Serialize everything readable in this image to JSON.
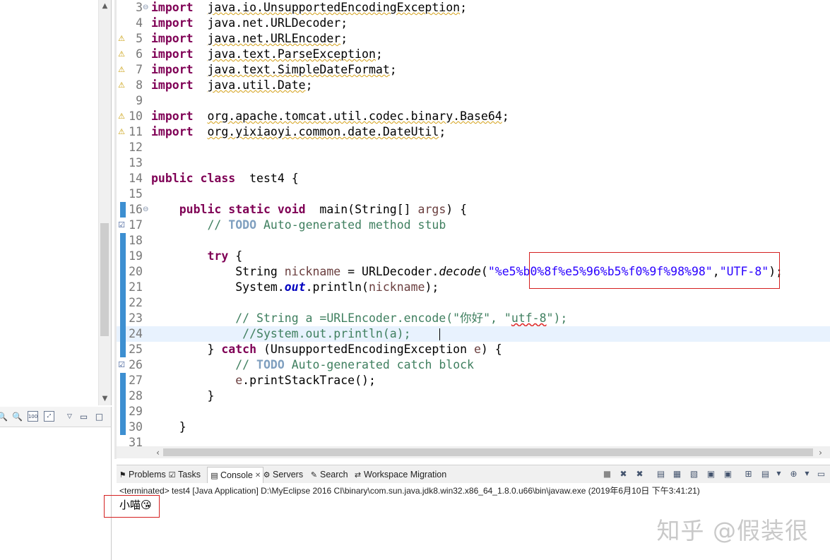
{
  "editor": {
    "lines": [
      {
        "num": "3",
        "fold": "⊖",
        "ann": "",
        "parts": [
          [
            "kw",
            "import"
          ],
          [
            "",
            "  "
          ],
          [
            "wavy",
            "java.io.UnsupportedEncodingException"
          ],
          [
            "",
            ";"
          ]
        ]
      },
      {
        "num": "4",
        "fold": "",
        "ann": "",
        "parts": [
          [
            "kw",
            "import"
          ],
          [
            "",
            "  java.net.URLDecoder;"
          ]
        ]
      },
      {
        "num": "5",
        "fold": "",
        "ann": "warn",
        "parts": [
          [
            "kw",
            "import"
          ],
          [
            "",
            "  "
          ],
          [
            "wavy",
            "java.net.URLEncoder"
          ],
          [
            "",
            ";"
          ]
        ]
      },
      {
        "num": "6",
        "fold": "",
        "ann": "warn",
        "parts": [
          [
            "kw",
            "import"
          ],
          [
            "",
            "  "
          ],
          [
            "wavy",
            "java.text.ParseException"
          ],
          [
            "",
            ";"
          ]
        ]
      },
      {
        "num": "7",
        "fold": "",
        "ann": "warn",
        "parts": [
          [
            "kw",
            "import"
          ],
          [
            "",
            "  "
          ],
          [
            "wavy",
            "java.text.SimpleDateFormat"
          ],
          [
            "",
            ";"
          ]
        ]
      },
      {
        "num": "8",
        "fold": "",
        "ann": "warn",
        "parts": [
          [
            "kw",
            "import"
          ],
          [
            "",
            "  "
          ],
          [
            "wavy",
            "java.util.Date"
          ],
          [
            "",
            ";"
          ]
        ]
      },
      {
        "num": "9",
        "fold": "",
        "ann": "",
        "parts": []
      },
      {
        "num": "10",
        "fold": "",
        "ann": "warn",
        "parts": [
          [
            "kw",
            "import"
          ],
          [
            "",
            "  "
          ],
          [
            "wavy",
            "org.apache.tomcat.util.codec.binary.Base64"
          ],
          [
            "",
            ";"
          ]
        ]
      },
      {
        "num": "11",
        "fold": "",
        "ann": "warn",
        "parts": [
          [
            "kw",
            "import"
          ],
          [
            "",
            "  "
          ],
          [
            "wavy",
            "org.yixiaoyi.common.date.DateUtil"
          ],
          [
            "",
            ";"
          ]
        ]
      },
      {
        "num": "12",
        "fold": "",
        "ann": "",
        "parts": []
      },
      {
        "num": "13",
        "fold": "",
        "ann": "",
        "parts": []
      },
      {
        "num": "14",
        "fold": "",
        "ann": "",
        "parts": [
          [
            "kw",
            "public class"
          ],
          [
            "",
            "  test4 {"
          ]
        ]
      },
      {
        "num": "15",
        "fold": "",
        "ann": "",
        "parts": []
      },
      {
        "num": "16",
        "fold": "⊖",
        "ann": "blue",
        "parts": [
          [
            "",
            "    "
          ],
          [
            "kw",
            "public static void"
          ],
          [
            "",
            "  main(String[] "
          ],
          [
            "vr",
            "args"
          ],
          [
            "",
            ") {"
          ]
        ]
      },
      {
        "num": "17",
        "fold": "",
        "ann": "task",
        "parts": [
          [
            "",
            "        "
          ],
          [
            "cm",
            "// "
          ],
          [
            "todo",
            "TODO"
          ],
          [
            "cm",
            " Auto-generated method stub"
          ]
        ]
      },
      {
        "num": "18",
        "fold": "",
        "ann": "blue",
        "parts": []
      },
      {
        "num": "19",
        "fold": "",
        "ann": "blue",
        "parts": [
          [
            "",
            "        "
          ],
          [
            "kw",
            "try"
          ],
          [
            "",
            " {"
          ]
        ]
      },
      {
        "num": "20",
        "fold": "",
        "ann": "blue",
        "parts": [
          [
            "",
            "            String "
          ],
          [
            "vr",
            "nickname"
          ],
          [
            "",
            " = URLDecoder."
          ],
          [
            "it",
            "decode"
          ],
          [
            "",
            "("
          ],
          [
            "st",
            "\"%e5%b0%8f%e5%96%b5%f0%9f%98%98\""
          ],
          [
            "",
            ","
          ],
          [
            "st",
            "\"UTF-8\""
          ],
          [
            "",
            ");"
          ]
        ]
      },
      {
        "num": "21",
        "fold": "",
        "ann": "blue",
        "parts": [
          [
            "",
            "            System."
          ],
          [
            "fld",
            "out"
          ],
          [
            "",
            ".println("
          ],
          [
            "vr",
            "nickname"
          ],
          [
            "",
            ");"
          ]
        ]
      },
      {
        "num": "22",
        "fold": "",
        "ann": "blue",
        "parts": []
      },
      {
        "num": "23",
        "fold": "",
        "ann": "blue",
        "parts": [
          [
            "",
            "            "
          ],
          [
            "cm",
            "// String a =URLEncoder.encode(\"你好\", \""
          ],
          [
            "cm wavy-red",
            "utf-8"
          ],
          [
            "cm",
            "\");"
          ]
        ]
      },
      {
        "num": "24",
        "fold": "",
        "ann": "blue",
        "current": true,
        "parts": [
          [
            "",
            "             "
          ],
          [
            "cm",
            "//System.out.println(a);"
          ]
        ]
      },
      {
        "num": "25",
        "fold": "",
        "ann": "blue",
        "parts": [
          [
            "",
            "        } "
          ],
          [
            "kw",
            "catch"
          ],
          [
            "",
            " (UnsupportedEncodingException "
          ],
          [
            "vr",
            "e"
          ],
          [
            "",
            ") {"
          ]
        ]
      },
      {
        "num": "26",
        "fold": "",
        "ann": "task",
        "parts": [
          [
            "",
            "            "
          ],
          [
            "cm",
            "// "
          ],
          [
            "todo",
            "TODO"
          ],
          [
            "cm",
            " Auto-generated catch block"
          ]
        ]
      },
      {
        "num": "27",
        "fold": "",
        "ann": "blue",
        "parts": [
          [
            "",
            "            "
          ],
          [
            "vr",
            "e"
          ],
          [
            "",
            ".printStackTrace();"
          ]
        ]
      },
      {
        "num": "28",
        "fold": "",
        "ann": "blue",
        "parts": [
          [
            "",
            "        }"
          ]
        ]
      },
      {
        "num": "29",
        "fold": "",
        "ann": "blue",
        "parts": []
      },
      {
        "num": "30",
        "fold": "",
        "ann": "blue",
        "parts": [
          [
            "",
            "    }"
          ]
        ]
      },
      {
        "num": "31",
        "fold": "",
        "ann": "",
        "parts": []
      }
    ]
  },
  "views": {
    "tabs": [
      {
        "label": "Problems",
        "icon": "problems-icon",
        "glyph": "⚑"
      },
      {
        "label": "Tasks",
        "icon": "tasks-icon",
        "glyph": "☑"
      },
      {
        "label": "Console",
        "icon": "console-icon",
        "glyph": "▤",
        "active": true
      },
      {
        "label": "Servers",
        "icon": "servers-icon",
        "glyph": "⚙"
      },
      {
        "label": "Search",
        "icon": "search-icon",
        "glyph": "✎"
      },
      {
        "label": "Workspace Migration",
        "icon": "workspace-migration-icon",
        "glyph": "⇄"
      }
    ],
    "close_glyph": "✕"
  },
  "console": {
    "terminated": "<terminated> test4 [Java Application] D:\\MyEclipse 2016 CI\\binary\\com.sun.java.jdk8.win32.x86_64_1.8.0.u66\\bin\\javaw.exe (2019年6月10日 下午3:41:21)",
    "output": "小喵😘"
  },
  "watermark": "知乎 @假装很"
}
